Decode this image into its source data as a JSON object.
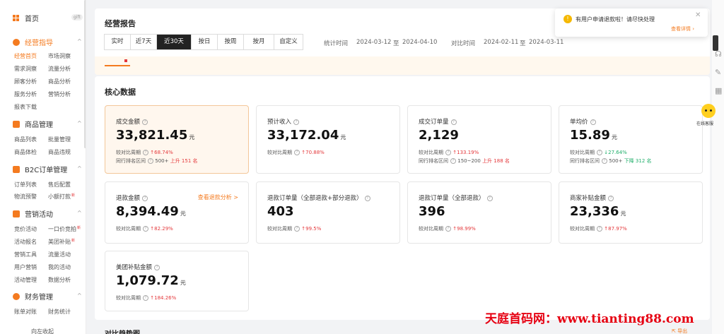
{
  "sidebar": {
    "home": "首页",
    "home_badge": "gift",
    "groups": [
      {
        "label": "经营指导",
        "items": [
          "经营首页",
          "市场洞察",
          "需求洞察",
          "流量分析",
          "顾客分析",
          "商品分析",
          "服务分析",
          "营销分析",
          "报表下载"
        ]
      },
      {
        "label": "商品管理",
        "items": [
          "商品列表",
          "批量管理",
          "商品体检",
          "商品违规"
        ]
      },
      {
        "label": "B2C订单管理",
        "items": [
          "订单列表",
          "售后配置",
          "物流预警",
          "小额打款"
        ]
      },
      {
        "label": "营销活动",
        "items": [
          "竞价活动",
          "一口价竞拍",
          "活动报名",
          "美团补贴",
          "营销工具",
          "流量活动",
          "用户营销",
          "我的活动",
          "活动管理",
          "数据分析"
        ]
      },
      {
        "label": "财务管理",
        "items": [
          "账单对账",
          "财务统计"
        ]
      }
    ],
    "new_tag": "新",
    "last_item": "向左收起"
  },
  "report": {
    "title": "经营报告",
    "tabs": [
      "实时",
      "近7天",
      "近30天",
      "按日",
      "按周",
      "按月",
      "自定义"
    ],
    "active_tab": "近30天",
    "stat_label": "统计时间",
    "stat_start": "2024-03-12",
    "stat_to": "至",
    "stat_end": "2024-04-10",
    "cmp_label": "对比时间",
    "cmp_start": "2024-02-11",
    "cmp_to": "至",
    "cmp_end": "2024-03-11"
  },
  "core": {
    "title": "核心数据",
    "compare_label": "较对比周期",
    "rank_label": "同行排名区间",
    "cards": [
      {
        "label": "成交金额",
        "value": "33,821.45",
        "unit": "元",
        "change": "68.74%",
        "rank": "500+",
        "rank_change": "上升 151 名"
      },
      {
        "label": "预计收入",
        "value": "33,172.04",
        "unit": "元",
        "change": "70.88%"
      },
      {
        "label": "成交订单量",
        "value": "2,129",
        "unit": "",
        "change": "133.19%",
        "rank": "150~200",
        "rank_change": "上升 188 名"
      },
      {
        "label": "单均价",
        "value": "15.89",
        "unit": "元",
        "change": "27.64%",
        "rank": "500+",
        "rank_change": "下降 312 名"
      },
      {
        "label": "退款金额",
        "value": "8,394.49",
        "unit": "元",
        "change": "82.29%",
        "link": "查看退款分析 >"
      },
      {
        "label": "退款订单量（全部退款+部分退款）",
        "value": "403",
        "unit": "",
        "change": "99.5%"
      },
      {
        "label": "退款订单量（全部退款）",
        "value": "396",
        "unit": "",
        "change": "98.99%"
      },
      {
        "label": "商家补贴金额",
        "value": "23,336",
        "unit": "元",
        "change": "87.97%"
      },
      {
        "label": "美团补贴金额",
        "value": "1,079.72",
        "unit": "元",
        "change": "184.26%"
      }
    ]
  },
  "bottom_title": "对比趋势图",
  "export": "导出",
  "notification": {
    "text": "有用户申请退款啦！请尽快处理",
    "link": "查看详情 ›"
  },
  "chat_label": "在线客服",
  "watermark": "天庭首码网：www.tianting88.com",
  "colors": {
    "accent": "#f47b20",
    "up": "#e4393c",
    "down": "#1fae6a",
    "watermark": "#e60012"
  }
}
